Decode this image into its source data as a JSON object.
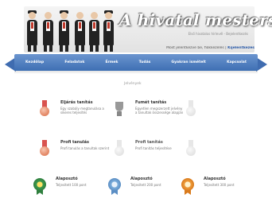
{
  "header": {
    "site_title": "A hivatal mesters",
    "tagline": "Első hivatalos hírlevél - Bejelentkezés",
    "login_text": "Most jelentkezve be, fiókkezelés |",
    "login_link": "Kijelentkezés"
  },
  "nav": {
    "items": [
      {
        "label": "Kezdőlap"
      },
      {
        "label": "Feladatok"
      },
      {
        "label": "Érmek"
      },
      {
        "label": "Tudás"
      },
      {
        "label": "Gyakran ismételt"
      },
      {
        "label": "Kapcsolat"
      }
    ]
  },
  "main": {
    "section_title": "Jelvények",
    "badges": [
      {
        "name": "Eljárás tanítás",
        "desc": "Egy szabály megtanulása a sikeres teljesítés",
        "style": "red-medal"
      },
      {
        "name": "Fumét tanítás",
        "desc": "Egyetlen megszerzett jelvény a tanultak összessége alapján",
        "style": "gray-medal"
      },
      {
        "name": "Profi tanulás",
        "desc": "Profi tanulás a tanultak szerint",
        "style": "red-medal"
      },
      {
        "name": "Profi tanítás",
        "desc": "Profi tanítás teljesítése",
        "style": "gray-medal"
      },
      {
        "name": "Alaposztó",
        "desc": "Teljesített 100 pont",
        "style": "green-rosette"
      },
      {
        "name": "Alaposztó",
        "desc": "Teljesített 200 pont",
        "style": "blue-rosette"
      },
      {
        "name": "Alaposztó",
        "desc": "Teljesített 300 pont",
        "style": "orange-rosette"
      }
    ]
  },
  "colors": {
    "ribbon": "#4f7fc1",
    "accent_link": "#2a5aa8"
  }
}
